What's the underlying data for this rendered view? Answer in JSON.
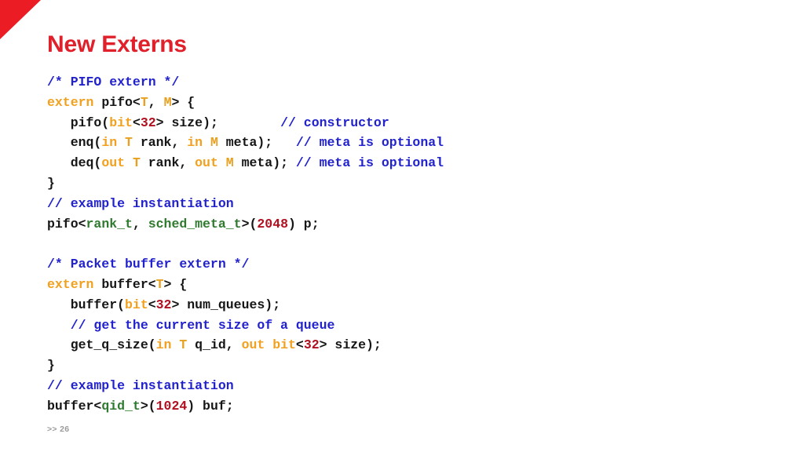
{
  "slide": {
    "title": "New Externs",
    "page_label": ">> 26",
    "accent_color": "#E0202A",
    "corner_color": "#EC1C24",
    "background_color": "#ffffff"
  },
  "syntax_colors": {
    "plain": "#151515",
    "comment": "#2222CC",
    "keyword": "#F2A01E",
    "type": "#E8A020",
    "number": "#B01020",
    "usertype": "#2F7A2F"
  },
  "code": {
    "lines": [
      {
        "id": "pifo-block-comment",
        "tokens": [
          {
            "t": "/* PIFO extern */",
            "c": "comment"
          }
        ]
      },
      {
        "id": "pifo-extern-decl",
        "tokens": [
          {
            "t": "extern",
            "c": "keyword"
          },
          {
            "t": " pifo<",
            "c": "plain"
          },
          {
            "t": "T",
            "c": "type"
          },
          {
            "t": ", ",
            "c": "plain"
          },
          {
            "t": "M",
            "c": "type"
          },
          {
            "t": "> {",
            "c": "plain"
          }
        ]
      },
      {
        "id": "pifo-constructor",
        "tokens": [
          {
            "t": "   pifo(",
            "c": "plain"
          },
          {
            "t": "bit",
            "c": "keyword"
          },
          {
            "t": "<",
            "c": "plain"
          },
          {
            "t": "32",
            "c": "number"
          },
          {
            "t": "> size);        ",
            "c": "plain"
          },
          {
            "t": "// constructor",
            "c": "comment"
          }
        ]
      },
      {
        "id": "pifo-enq",
        "tokens": [
          {
            "t": "   enq(",
            "c": "plain"
          },
          {
            "t": "in",
            "c": "keyword"
          },
          {
            "t": " ",
            "c": "plain"
          },
          {
            "t": "T",
            "c": "type"
          },
          {
            "t": " rank, ",
            "c": "plain"
          },
          {
            "t": "in",
            "c": "keyword"
          },
          {
            "t": " ",
            "c": "plain"
          },
          {
            "t": "M",
            "c": "type"
          },
          {
            "t": " meta);   ",
            "c": "plain"
          },
          {
            "t": "// meta is optional",
            "c": "comment"
          }
        ]
      },
      {
        "id": "pifo-deq",
        "tokens": [
          {
            "t": "   deq(",
            "c": "plain"
          },
          {
            "t": "out",
            "c": "keyword"
          },
          {
            "t": " ",
            "c": "plain"
          },
          {
            "t": "T",
            "c": "type"
          },
          {
            "t": " rank, ",
            "c": "plain"
          },
          {
            "t": "out",
            "c": "keyword"
          },
          {
            "t": " ",
            "c": "plain"
          },
          {
            "t": "M",
            "c": "type"
          },
          {
            "t": " meta); ",
            "c": "plain"
          },
          {
            "t": "// meta is optional",
            "c": "comment"
          }
        ]
      },
      {
        "id": "pifo-close-brace",
        "tokens": [
          {
            "t": "}",
            "c": "plain"
          }
        ]
      },
      {
        "id": "pifo-example-comment",
        "tokens": [
          {
            "t": "// example instantiation",
            "c": "comment"
          }
        ]
      },
      {
        "id": "pifo-instantiation",
        "tokens": [
          {
            "t": "pifo<",
            "c": "plain"
          },
          {
            "t": "rank_t",
            "c": "usertype"
          },
          {
            "t": ", ",
            "c": "plain"
          },
          {
            "t": "sched_meta_t",
            "c": "usertype"
          },
          {
            "t": ">(",
            "c": "plain"
          },
          {
            "t": "2048",
            "c": "number"
          },
          {
            "t": ") p;",
            "c": "plain"
          }
        ]
      },
      {
        "id": "spacer-1",
        "tokens": []
      },
      {
        "id": "buffer-block-comment",
        "tokens": [
          {
            "t": "/* Packet buffer extern */",
            "c": "comment"
          }
        ]
      },
      {
        "id": "buffer-extern-decl",
        "tokens": [
          {
            "t": "extern",
            "c": "keyword"
          },
          {
            "t": " buffer<",
            "c": "plain"
          },
          {
            "t": "T",
            "c": "type"
          },
          {
            "t": "> {",
            "c": "plain"
          }
        ]
      },
      {
        "id": "buffer-constructor",
        "tokens": [
          {
            "t": "   buffer(",
            "c": "plain"
          },
          {
            "t": "bit",
            "c": "keyword"
          },
          {
            "t": "<",
            "c": "plain"
          },
          {
            "t": "32",
            "c": "number"
          },
          {
            "t": "> num_queues);",
            "c": "plain"
          }
        ]
      },
      {
        "id": "buffer-getsize-comment",
        "tokens": [
          {
            "t": "   ",
            "c": "plain"
          },
          {
            "t": "// get the current size of a queue",
            "c": "comment"
          }
        ]
      },
      {
        "id": "buffer-get-q-size",
        "tokens": [
          {
            "t": "   get_q_size(",
            "c": "plain"
          },
          {
            "t": "in",
            "c": "keyword"
          },
          {
            "t": " ",
            "c": "plain"
          },
          {
            "t": "T",
            "c": "type"
          },
          {
            "t": " q_id, ",
            "c": "plain"
          },
          {
            "t": "out",
            "c": "keyword"
          },
          {
            "t": " ",
            "c": "plain"
          },
          {
            "t": "bit",
            "c": "keyword"
          },
          {
            "t": "<",
            "c": "plain"
          },
          {
            "t": "32",
            "c": "number"
          },
          {
            "t": "> size);",
            "c": "plain"
          }
        ]
      },
      {
        "id": "buffer-close-brace",
        "tokens": [
          {
            "t": "}",
            "c": "plain"
          }
        ]
      },
      {
        "id": "buffer-example-comment",
        "tokens": [
          {
            "t": "// example instantiation",
            "c": "comment"
          }
        ]
      },
      {
        "id": "buffer-instantiation",
        "tokens": [
          {
            "t": "buffer<",
            "c": "plain"
          },
          {
            "t": "qid_t",
            "c": "usertype"
          },
          {
            "t": ">(",
            "c": "plain"
          },
          {
            "t": "1024",
            "c": "number"
          },
          {
            "t": ") buf;",
            "c": "plain"
          }
        ]
      }
    ]
  }
}
